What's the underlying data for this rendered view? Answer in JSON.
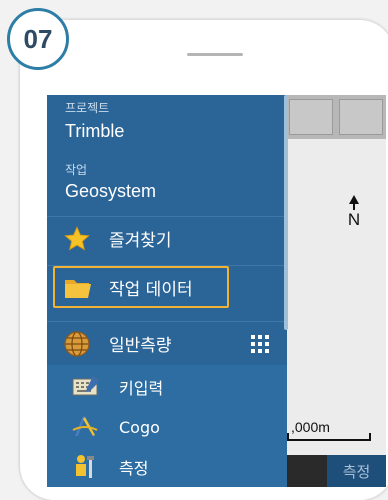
{
  "step_badge": "07",
  "menu": {
    "project_label": "프로젝트",
    "project_value": "Trimble",
    "job_label": "작업",
    "job_value": "Geosystem",
    "items": [
      {
        "label": "즐겨찾기",
        "icon": "star-icon"
      },
      {
        "label": "작업 데이터",
        "icon": "folder-icon"
      },
      {
        "label": "일반측량",
        "icon": "globe-icon"
      }
    ],
    "subitems": [
      {
        "label": "키입력",
        "icon": "keyboard-icon"
      },
      {
        "label": "Cogo",
        "icon": "cogo-compass-icon"
      },
      {
        "label": "측정",
        "icon": "surveyor-icon"
      }
    ],
    "grid_icon": "apps-grid-icon"
  },
  "map": {
    "north_label": "N",
    "scale_label": ",000m",
    "measure_button": "측정"
  },
  "colors": {
    "menu_bg": "#2b6598",
    "highlight": "#f2b233",
    "badge_border": "#2d7ea6"
  }
}
